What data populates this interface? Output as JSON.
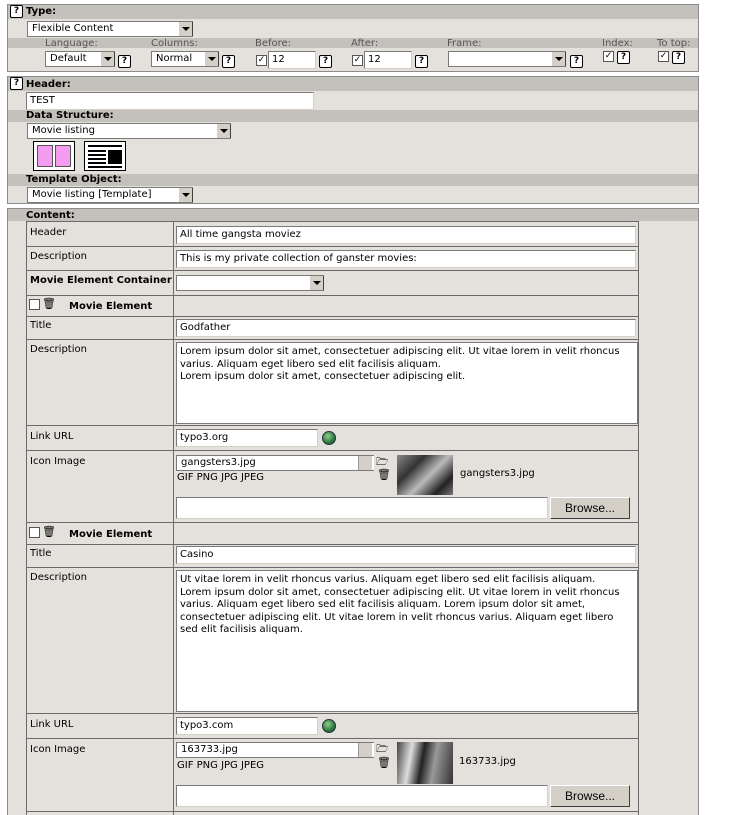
{
  "type_section": {
    "label": "Type:",
    "type_value": "Flexible Content",
    "language_label": "Language:",
    "language_value": "Default",
    "columns_label": "Columns:",
    "columns_value": "Normal",
    "before_label": "Before:",
    "before_value": "12",
    "after_label": "After:",
    "after_value": "12",
    "frame_label": "Frame:",
    "frame_value": "",
    "index_label": "Index:",
    "totop_label": "To top:",
    "check_mark": "✓",
    "help_glyph": "?"
  },
  "header_section": {
    "header_label": "Header:",
    "header_value": "TEST",
    "ds_label": "Data Structure:",
    "ds_value": "Movie listing",
    "to_label": "Template Object:",
    "to_value": "Movie listing [Template]"
  },
  "content": {
    "label": "Content:",
    "header_field_label": "Header",
    "header_field_value": "All time gangsta moviez",
    "description_label": "Description",
    "description_value": "This is my private collection of ganster movies:",
    "container_label": "Movie Element Container",
    "container_value": "",
    "elements": [
      {
        "heading": "Movie Element",
        "title_label": "Title",
        "title_value": "Godfather",
        "desc_label": "Description",
        "desc_value": "Lorem ipsum dolor sit amet, consectetuer adipiscing elit. Ut vitae lorem in velit rhoncus varius. Aliquam eget libero sed elit facilisis aliquam.\nLorem ipsum dolor sit amet, consectetuer adipiscing elit.",
        "link_label": "Link URL",
        "link_value": "typo3.org",
        "icon_label": "Icon Image",
        "file_value": "gangsters3.jpg",
        "file_types": "GIF PNG JPG JPEG",
        "thumb_caption": "gangsters3.jpg",
        "browse_label": "Browse..."
      },
      {
        "heading": "Movie Element",
        "title_label": "Title",
        "title_value": "Casino",
        "desc_label": "Description",
        "desc_value": "Ut vitae lorem in velit rhoncus varius. Aliquam eget libero sed elit facilisis aliquam.\nLorem ipsum dolor sit amet, consectetuer adipiscing elit. Ut vitae lorem in velit rhoncus varius. Aliquam eget libero sed elit facilisis aliquam. Lorem ipsum dolor sit amet, consectetuer adipiscing elit. Ut vitae lorem in velit rhoncus varius. Aliquam eget libero sed elit facilisis aliquam.",
        "link_label": "Link URL",
        "link_value": "typo3.com",
        "icon_label": "Icon Image",
        "file_value": "163733.jpg",
        "file_types": "GIF PNG JPG JPEG",
        "thumb_caption": "163733.jpg",
        "browse_label": "Browse..."
      }
    ]
  }
}
